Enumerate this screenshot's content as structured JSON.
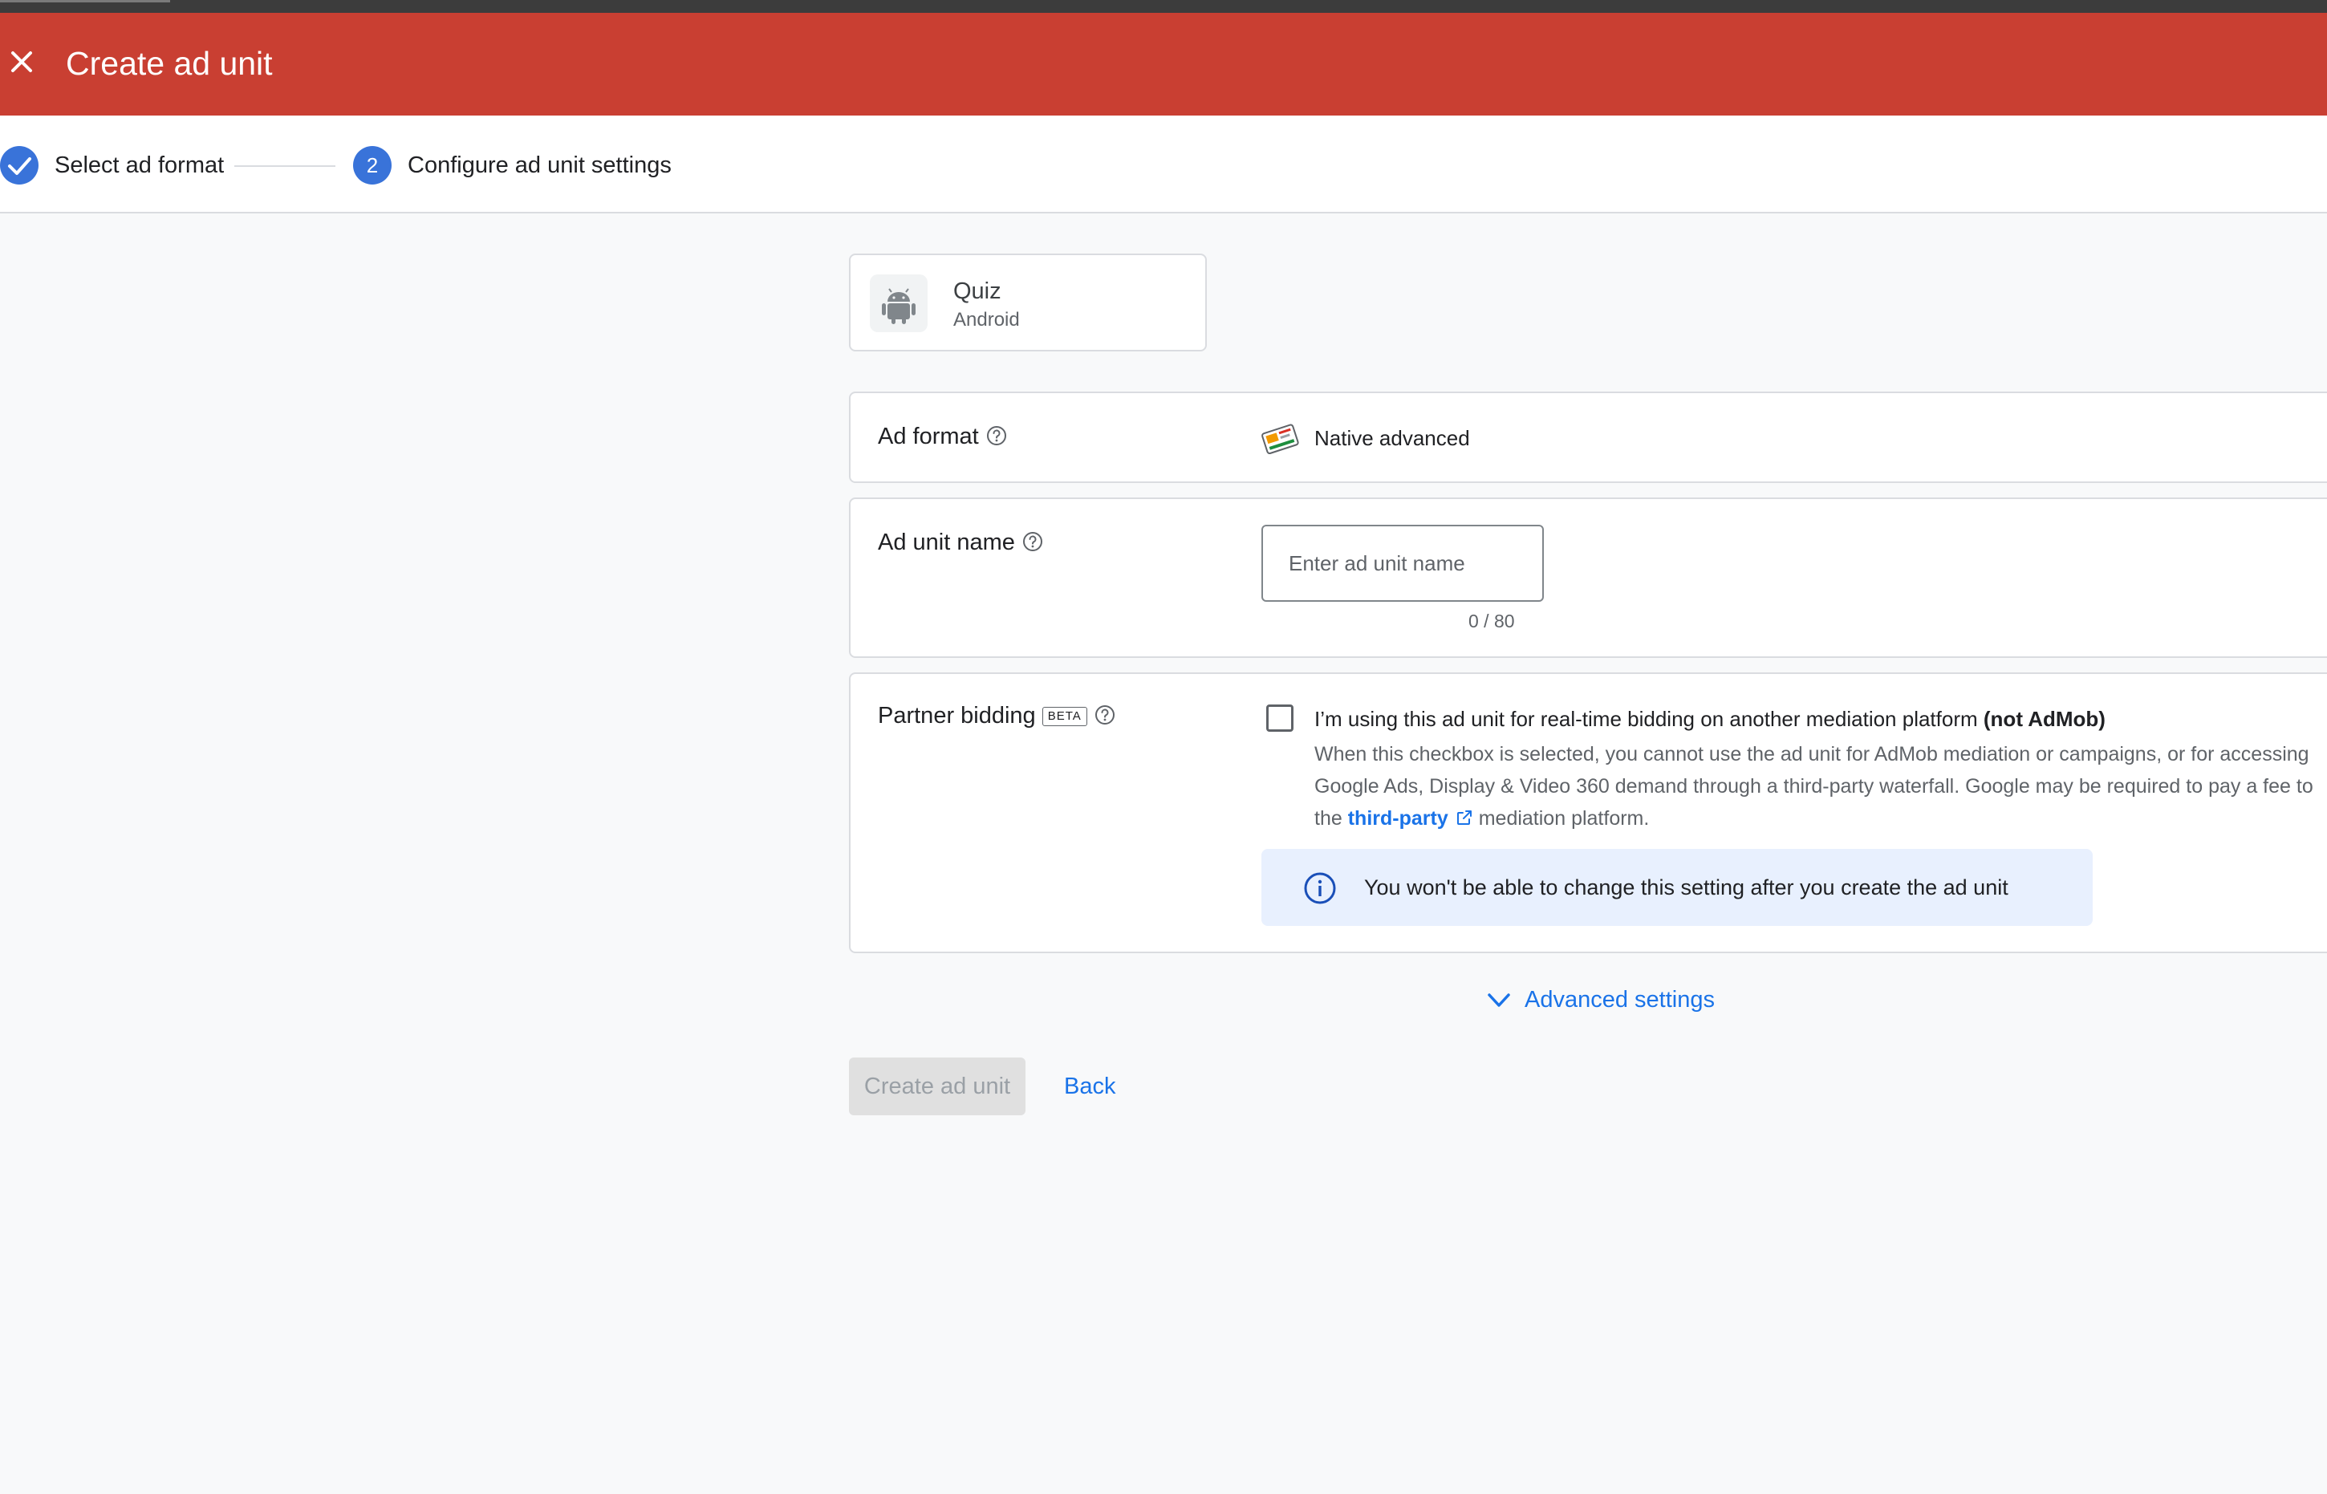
{
  "header": {
    "title": "Create ad unit"
  },
  "stepper": {
    "steps": [
      {
        "label": "Select ad format",
        "state": "completed"
      },
      {
        "number": "2",
        "label": "Configure ad unit settings",
        "state": "current"
      }
    ]
  },
  "app": {
    "name": "Quiz",
    "platform": "Android",
    "icon": "android-icon"
  },
  "ad_format": {
    "label": "Ad format",
    "value": "Native advanced"
  },
  "ad_unit_name": {
    "label": "Ad unit name",
    "placeholder": "Enter ad unit name",
    "value": "",
    "counter": "0 / 80"
  },
  "partner_bidding": {
    "label": "Partner bidding",
    "badge": "BETA",
    "checked": false,
    "checkbox_label": "I’m using this ad unit for real-time bidding on another mediation platform",
    "checkbox_label_bold": "(not AdMob)",
    "description_part1": "When this checkbox is selected, you cannot use the ad unit for AdMob mediation or campaigns, or for accessing Google Ads, Display & Video 360 demand through a third-party waterfall. Google may be required to pay a fee to the",
    "link_text": "third-party",
    "description_part2": "mediation platform.",
    "info_text": "You won't be able to change this setting after you create the ad unit"
  },
  "advanced_settings": {
    "label": "Advanced settings"
  },
  "actions": {
    "create_label": "Create ad unit",
    "create_disabled": true,
    "back_label": "Back"
  },
  "colors": {
    "header_bg": "#c93f32",
    "accent_blue": "#1a73e8",
    "step_blue": "#3973d9",
    "info_bg": "#e8f0fe"
  }
}
